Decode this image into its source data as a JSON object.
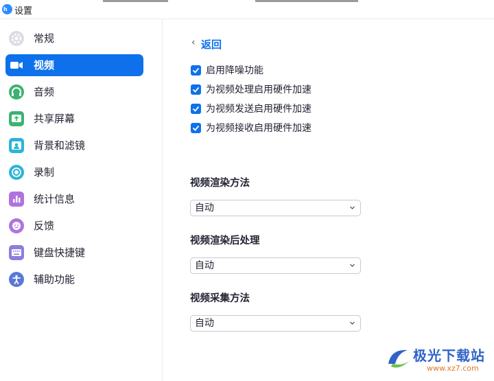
{
  "window": {
    "title": "设置"
  },
  "sidebar": {
    "items": [
      {
        "label": "常规",
        "icon": "gear-icon",
        "color": "#cfcfd6"
      },
      {
        "label": "视频",
        "icon": "video-camera-icon",
        "color": "#ffffff",
        "active": true
      },
      {
        "label": "音频",
        "icon": "headphones-icon",
        "color": "#3cb371"
      },
      {
        "label": "共享屏幕",
        "icon": "share-screen-icon",
        "color": "#3cb371"
      },
      {
        "label": "背景和滤镜",
        "icon": "background-icon",
        "color": "#2bb5d6"
      },
      {
        "label": "录制",
        "icon": "record-icon",
        "color": "#2bb5d6"
      },
      {
        "label": "统计信息",
        "icon": "statistics-icon",
        "color": "#b073de"
      },
      {
        "label": "反馈",
        "icon": "feedback-icon",
        "color": "#b073de"
      },
      {
        "label": "键盘快捷键",
        "icon": "keyboard-icon",
        "color": "#8a7fe0"
      },
      {
        "label": "辅助功能",
        "icon": "accessibility-icon",
        "color": "#5a78d6"
      }
    ]
  },
  "main": {
    "back_label": "返回",
    "checkboxes": [
      {
        "label": "启用降噪功能",
        "checked": true
      },
      {
        "label": "为视频处理启用硬件加速",
        "checked": true
      },
      {
        "label": "为视频发送启用硬件加速",
        "checked": true
      },
      {
        "label": "为视频接收启用硬件加速",
        "checked": true
      }
    ],
    "sections": [
      {
        "title": "视频渲染方法",
        "selected": "自动"
      },
      {
        "title": "视频渲染后处理",
        "selected": "自动"
      },
      {
        "title": "视频采集方法",
        "selected": "自动"
      }
    ]
  },
  "watermark": {
    "name": "极光下载站",
    "url": "www.xz7.com"
  },
  "colors": {
    "accent": "#0e71eb",
    "text": "#232333"
  }
}
